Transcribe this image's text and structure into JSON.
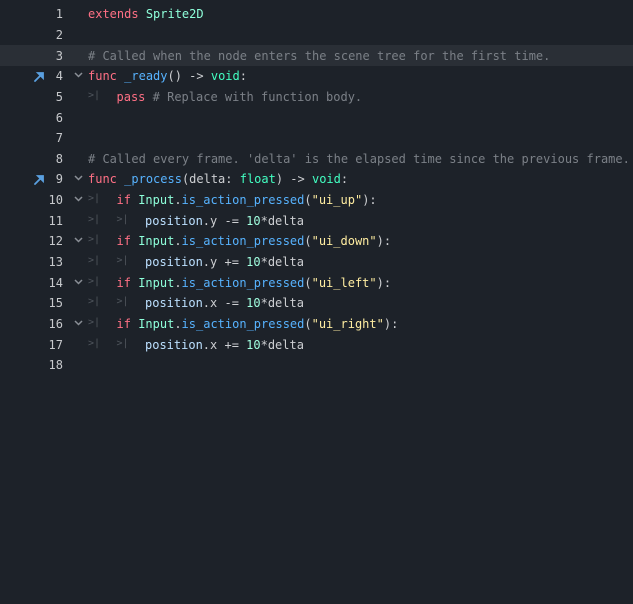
{
  "editor": {
    "current_line": 3,
    "lines": [
      {
        "n": "1",
        "indent": 0,
        "tokens": [
          {
            "t": "extends",
            "c": "kw"
          },
          {
            "t": " ",
            "c": "txt"
          },
          {
            "t": "Sprite2D",
            "c": "cls"
          }
        ]
      },
      {
        "n": "2",
        "indent": 0,
        "tokens": []
      },
      {
        "n": "3",
        "indent": 0,
        "tokens": [
          {
            "t": "# Called when the node enters the scene tree for the first time.",
            "c": "cm"
          }
        ]
      },
      {
        "n": "4",
        "indent": 0,
        "fold": true,
        "marker": true,
        "tokens": [
          {
            "t": "func",
            "c": "kw"
          },
          {
            "t": " ",
            "c": "txt"
          },
          {
            "t": "_ready",
            "c": "fn"
          },
          {
            "t": "() -> ",
            "c": "txt"
          },
          {
            "t": "void",
            "c": "type"
          },
          {
            "t": ":",
            "c": "txt"
          }
        ]
      },
      {
        "n": "5",
        "indent": 1,
        "tokens": [
          {
            "t": "pass",
            "c": "kw"
          },
          {
            "t": " ",
            "c": "txt"
          },
          {
            "t": "# Replace with function body.",
            "c": "cm"
          }
        ]
      },
      {
        "n": "6",
        "indent": 0,
        "tokens": []
      },
      {
        "n": "7",
        "indent": 0,
        "tokens": []
      },
      {
        "n": "8",
        "indent": 0,
        "tokens": [
          {
            "t": "# Called every frame. 'delta' is the elapsed time since the previous frame.",
            "c": "cm"
          }
        ]
      },
      {
        "n": "9",
        "indent": 0,
        "fold": true,
        "marker": true,
        "tokens": [
          {
            "t": "func",
            "c": "kw"
          },
          {
            "t": " ",
            "c": "txt"
          },
          {
            "t": "_process",
            "c": "fn"
          },
          {
            "t": "(delta: ",
            "c": "txt"
          },
          {
            "t": "float",
            "c": "type"
          },
          {
            "t": ") -> ",
            "c": "txt"
          },
          {
            "t": "void",
            "c": "type"
          },
          {
            "t": ":",
            "c": "txt"
          }
        ]
      },
      {
        "n": "10",
        "indent": 1,
        "fold": true,
        "tokens": [
          {
            "t": "if",
            "c": "kw"
          },
          {
            "t": " ",
            "c": "txt"
          },
          {
            "t": "Input",
            "c": "cls"
          },
          {
            "t": ".",
            "c": "txt"
          },
          {
            "t": "is_action_pressed",
            "c": "fn"
          },
          {
            "t": "(",
            "c": "txt"
          },
          {
            "t": "\"ui_up\"",
            "c": "str"
          },
          {
            "t": "):",
            "c": "txt"
          }
        ]
      },
      {
        "n": "11",
        "indent": 2,
        "tokens": [
          {
            "t": "position",
            "c": "member"
          },
          {
            "t": ".y -= ",
            "c": "txt"
          },
          {
            "t": "10",
            "c": "num"
          },
          {
            "t": "*delta",
            "c": "txt"
          }
        ]
      },
      {
        "n": "12",
        "indent": 1,
        "fold": true,
        "tokens": [
          {
            "t": "if",
            "c": "kw"
          },
          {
            "t": " ",
            "c": "txt"
          },
          {
            "t": "Input",
            "c": "cls"
          },
          {
            "t": ".",
            "c": "txt"
          },
          {
            "t": "is_action_pressed",
            "c": "fn"
          },
          {
            "t": "(",
            "c": "txt"
          },
          {
            "t": "\"ui_down\"",
            "c": "str"
          },
          {
            "t": "):",
            "c": "txt"
          }
        ]
      },
      {
        "n": "13",
        "indent": 2,
        "tokens": [
          {
            "t": "position",
            "c": "member"
          },
          {
            "t": ".y += ",
            "c": "txt"
          },
          {
            "t": "10",
            "c": "num"
          },
          {
            "t": "*delta",
            "c": "txt"
          }
        ]
      },
      {
        "n": "14",
        "indent": 1,
        "fold": true,
        "tokens": [
          {
            "t": "if",
            "c": "kw"
          },
          {
            "t": " ",
            "c": "txt"
          },
          {
            "t": "Input",
            "c": "cls"
          },
          {
            "t": ".",
            "c": "txt"
          },
          {
            "t": "is_action_pressed",
            "c": "fn"
          },
          {
            "t": "(",
            "c": "txt"
          },
          {
            "t": "\"ui_left\"",
            "c": "str"
          },
          {
            "t": "):",
            "c": "txt"
          }
        ]
      },
      {
        "n": "15",
        "indent": 2,
        "tokens": [
          {
            "t": "position",
            "c": "member"
          },
          {
            "t": ".x -= ",
            "c": "txt"
          },
          {
            "t": "10",
            "c": "num"
          },
          {
            "t": "*delta",
            "c": "txt"
          }
        ]
      },
      {
        "n": "16",
        "indent": 1,
        "fold": true,
        "tokens": [
          {
            "t": "if",
            "c": "kw"
          },
          {
            "t": " ",
            "c": "txt"
          },
          {
            "t": "Input",
            "c": "cls"
          },
          {
            "t": ".",
            "c": "txt"
          },
          {
            "t": "is_action_pressed",
            "c": "fn"
          },
          {
            "t": "(",
            "c": "txt"
          },
          {
            "t": "\"ui_right\"",
            "c": "str"
          },
          {
            "t": "):",
            "c": "txt"
          }
        ]
      },
      {
        "n": "17",
        "indent": 2,
        "tokens": [
          {
            "t": "position",
            "c": "member"
          },
          {
            "t": ".x += ",
            "c": "txt"
          },
          {
            "t": "10",
            "c": "num"
          },
          {
            "t": "*delta",
            "c": "txt"
          }
        ]
      },
      {
        "n": "18",
        "indent": 0,
        "tokens": []
      }
    ]
  },
  "icons": {
    "fold": "chevron-down-icon",
    "indent": "tab-indent-icon",
    "marker": "override-arrow-icon"
  },
  "colors": {
    "background": "#1d2229",
    "current_line": "#2a2f36",
    "keyword": "#ff7085",
    "comment": "#7b8087",
    "string": "#ffeda1",
    "function": "#57b3ff"
  }
}
